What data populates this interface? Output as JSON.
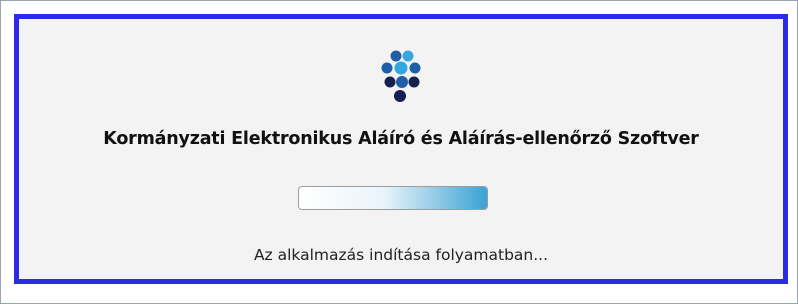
{
  "splash": {
    "title": "Kormányzati Elektronikus Aláíró és Aláírás-ellenőrző Szoftver",
    "status": "Az alkalmazás indítása folyamatban...",
    "progress": 1.0,
    "logo_icon": "dots-logo-icon"
  },
  "colors": {
    "frame_border": "#2b2be3",
    "background": "#f3f3f3",
    "logo_light": "#35a7e0",
    "logo_mid": "#1f5fa8",
    "logo_dark": "#161f4f",
    "progress_accent": "#3aa2d6"
  }
}
